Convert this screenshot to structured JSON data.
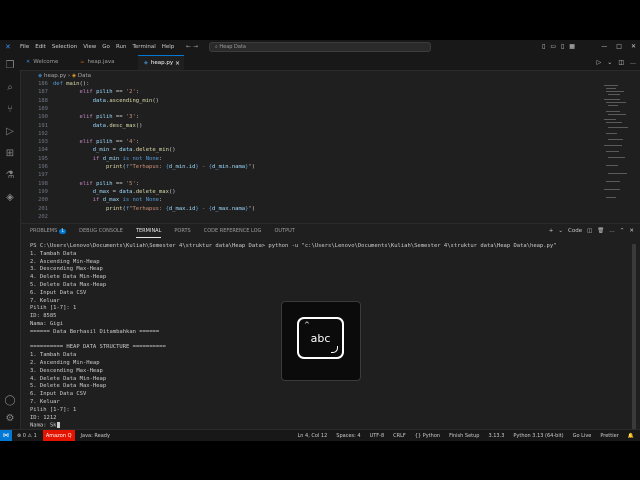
{
  "titlebar": {
    "menu": [
      "File",
      "Edit",
      "Selection",
      "View",
      "Go",
      "Run",
      "Terminal",
      "Help"
    ],
    "search": "Heap Data"
  },
  "tabs": [
    {
      "label": "Welcome",
      "icon": "vscode-icon",
      "active": false
    },
    {
      "label": "heap.java",
      "icon": "java-icon",
      "active": false
    },
    {
      "label": "heap.py",
      "icon": "python-icon",
      "active": true
    }
  ],
  "breadcrumb": [
    "heap.py",
    "Data"
  ],
  "editor": {
    "lines": [
      {
        "n": "186",
        "t": "def main():"
      },
      {
        "n": "187",
        "t": "        elif pilih == '2':"
      },
      {
        "n": "188",
        "t": "            data.ascending_min()"
      },
      {
        "n": "189",
        "t": ""
      },
      {
        "n": "190",
        "t": "        elif pilih == '3':"
      },
      {
        "n": "191",
        "t": "            data.desc_max()"
      },
      {
        "n": "192",
        "t": ""
      },
      {
        "n": "193",
        "t": "        elif pilih == '4':"
      },
      {
        "n": "194",
        "t": "            d_min = data.delete_min()"
      },
      {
        "n": "195",
        "t": "            if d_min is not None:"
      },
      {
        "n": "196",
        "t": "                print(f\"Terhapus: {d_min.id} - {d_min.nama}\")"
      },
      {
        "n": "197",
        "t": ""
      },
      {
        "n": "198",
        "t": "        elif pilih == '5':"
      },
      {
        "n": "199",
        "t": "            d_max = data.delete_max()"
      },
      {
        "n": "200",
        "t": "            if d_max is not None:"
      },
      {
        "n": "201",
        "t": "                print(f\"Terhapus: {d_max.id} - {d_max.nama}\")"
      },
      {
        "n": "202",
        "t": ""
      }
    ]
  },
  "panel": {
    "tabs": [
      "PROBLEMS",
      "DEBUG CONSOLE",
      "TERMINAL",
      "PORTS",
      "CODE REFERENCE LOG",
      "OUTPUT"
    ],
    "problems_badge": "1",
    "active_tab": "TERMINAL",
    "shell_label": "Code"
  },
  "terminal": {
    "lines": [
      "PS C:\\Users\\Lenovo\\Documents\\Kuliah\\Semester 4\\struktur data\\Heap Data> python -u \"c:\\Users\\Lenovo\\Documents\\Kuliah\\Semester 4\\struktur data\\Heap Data\\heap.py\"",
      "1. Tambah Data",
      "2. Ascending Min-Heap",
      "3. Descending Max-Heap",
      "4. Delete Data Min-Heap",
      "5. Delete Data Max-Heap",
      "6. Input Data CSV",
      "7. Keluar",
      "Pilih [1-7]: 1",
      "ID: 8585",
      "Nama: Gigi",
      "====== Data Berhasil Ditambahkan ======",
      "",
      "========== HEAP DATA STRUCTURE ==========",
      "1. Tambah Data",
      "2. Ascending Min-Heap",
      "3. Descending Max-Heap",
      "4. Delete Data Min-Heap",
      "5. Delete Data Max-Heap",
      "6. Input Data CSV",
      "7. Keluar",
      "Pilih [1-7]: 1",
      "ID: 1212",
      "Nama: Sk"
    ]
  },
  "statusbar": {
    "left": [
      "⊗ 0 ⚠ 1",
      "Amazon Q",
      "Java: Ready"
    ],
    "right": [
      "Ln 4, Col 12",
      "Spaces: 4",
      "UTF-8",
      "CRLF",
      "{} Python",
      "Finish Setup",
      "3.13.3",
      "Python 3.13 (64-bit)",
      "Go Live",
      "Prettier"
    ]
  },
  "overlay": {
    "label": "abc",
    "icon": "keyboard-input-icon"
  }
}
